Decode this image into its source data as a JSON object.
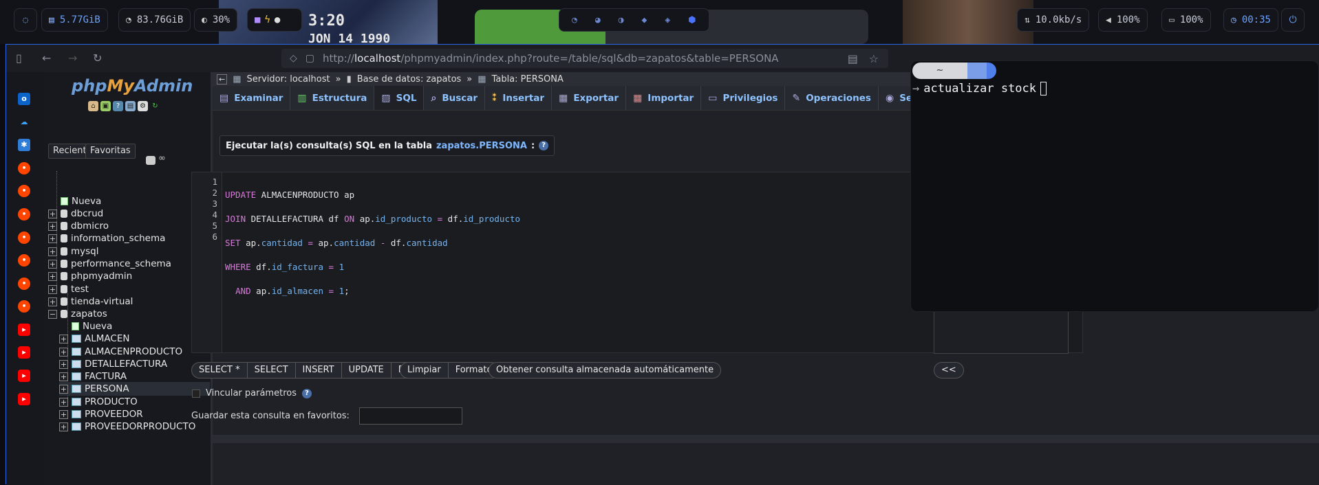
{
  "topbar": {
    "mem": "5.77GiB",
    "disk": "83.76GiB",
    "cpu": "30%",
    "net": "10.0kb/s",
    "volume": "100%",
    "battery": "100%",
    "clock": "00:35"
  },
  "wallpaper_clock": {
    "time": "3:20",
    "date": "JON 14 1990"
  },
  "browser": {
    "url_prefix": "http://",
    "url_host": "localhost",
    "url_path": "/phpmyadmin/index.php?route=/table/sql&db=zapatos&table=PERSONA"
  },
  "pma": {
    "logo_php": "php",
    "logo_my": "My",
    "logo_admin": "Admin",
    "recent_label": "Reciente",
    "favorites_label": "Favoritas",
    "tree": [
      {
        "label": "Nueva",
        "level": 0,
        "kind": "new"
      },
      {
        "label": "dbcrud",
        "level": 0,
        "kind": "db"
      },
      {
        "label": "dbmicro",
        "level": 0,
        "kind": "db"
      },
      {
        "label": "information_schema",
        "level": 0,
        "kind": "db"
      },
      {
        "label": "mysql",
        "level": 0,
        "kind": "db"
      },
      {
        "label": "performance_schema",
        "level": 0,
        "kind": "db"
      },
      {
        "label": "phpmyadmin",
        "level": 0,
        "kind": "db"
      },
      {
        "label": "test",
        "level": 0,
        "kind": "db"
      },
      {
        "label": "tienda-virtual",
        "level": 0,
        "kind": "db"
      },
      {
        "label": "zapatos",
        "level": 0,
        "kind": "db-open"
      },
      {
        "label": "Nueva",
        "level": 1,
        "kind": "new"
      },
      {
        "label": "ALMACEN",
        "level": 1,
        "kind": "table"
      },
      {
        "label": "ALMACENPRODUCTO",
        "level": 1,
        "kind": "table"
      },
      {
        "label": "DETALLEFACTURA",
        "level": 1,
        "kind": "table"
      },
      {
        "label": "FACTURA",
        "level": 1,
        "kind": "table"
      },
      {
        "label": "PERSONA",
        "level": 1,
        "kind": "table"
      },
      {
        "label": "PRODUCTO",
        "level": 1,
        "kind": "table"
      },
      {
        "label": "PROVEEDOR",
        "level": 1,
        "kind": "table"
      },
      {
        "label": "PROVEEDORPRODUCTO",
        "level": 1,
        "kind": "table"
      }
    ]
  },
  "breadcrumb": {
    "server": "Servidor: localhost",
    "database": "Base de datos: zapatos",
    "table": "Tabla: PERSONA"
  },
  "tabs": [
    "Examinar",
    "Estructura",
    "SQL",
    "Buscar",
    "Insertar",
    "Exportar",
    "Importar",
    "Privilegios",
    "Operaciones",
    "Seguimiento"
  ],
  "active_tab": "SQL",
  "query_legend": {
    "prefix": "Ejecutar la(s) consulta(s) SQL en la tabla",
    "table": "zapatos.PERSONA",
    "suffix": ":"
  },
  "sql_lines": [
    "1",
    "2",
    "3",
    "4",
    "5",
    "6"
  ],
  "buttons": {
    "select_star": "SELECT *",
    "select": "SELECT",
    "insert": "INSERT",
    "update": "UPDATE",
    "delete": "DELETE",
    "clear": "Limpiar",
    "format": "Formato",
    "autosaved": "Obtener consulta almacenada automáticamente",
    "collapse": "<<"
  },
  "bind_params_label": "Vincular parámetros",
  "save_fav_label": "Guardar esta consulta en favoritos:",
  "terminal": {
    "dir": "~",
    "command": "actualizar stock"
  }
}
